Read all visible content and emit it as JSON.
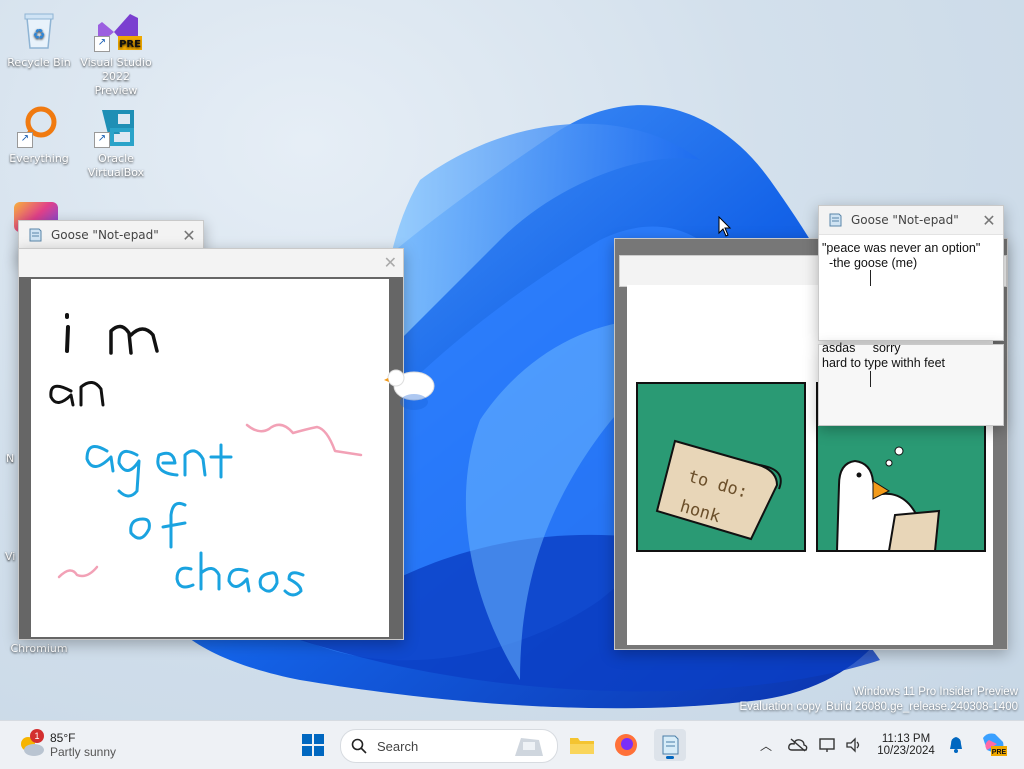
{
  "desktop_icons": [
    {
      "name": "recycle-bin",
      "label": "Recycle Bin"
    },
    {
      "name": "visual-studio",
      "label": "Visual Studio 2022 Preview",
      "badge": "PRE"
    },
    {
      "name": "everything",
      "label": "Everything"
    },
    {
      "name": "oracle-virtualbox",
      "label": "Oracle VirtualBox"
    },
    {
      "name": "chromium",
      "label": "Chromium"
    }
  ],
  "partial_icon_labels": [
    "N",
    "Vi"
  ],
  "notepad_window": {
    "title": "Goose \"Not-epad\""
  },
  "notes": {
    "top": {
      "title": "Goose \"Not-epad\"",
      "text": "\"peace was never an option\"\n  -the goose (me)"
    },
    "bottom": {
      "text": "asdas     sorry\nhard to type withh feet"
    }
  },
  "drawing": {
    "lines": [
      "i m",
      "an",
      "agent",
      "of",
      "chaos"
    ],
    "ink_colors": {
      "black": "#111111",
      "blue": "#1aa3e0",
      "pink": "#f2a1b6"
    }
  },
  "comic": {
    "panel1_text": [
      "to do:",
      "honk"
    ],
    "panel_bg": "#2a9a74"
  },
  "watermark": {
    "line1": "Windows 11 Pro Insider Preview",
    "line2": "Evaluation copy. Build 26080.ge_release.240308-1400"
  },
  "taskbar": {
    "weather": {
      "temp": "85°F",
      "desc": "Partly sunny",
      "badge": "1"
    },
    "search_placeholder": "Search",
    "clock": {
      "time": "11:13 PM",
      "date": "10/23/2024"
    },
    "copilot_badge": "PRE"
  },
  "colors": {
    "accent": "#0067c0",
    "taskbar_bg": "#eef1f5",
    "wallpaper_blue": "#1565e0"
  }
}
